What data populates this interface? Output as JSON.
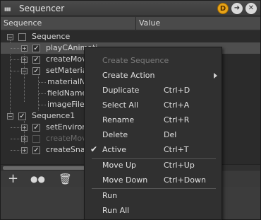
{
  "window": {
    "title": "Sequencer",
    "title_icons": [
      "d-badge-icon",
      "arrow-right-icon",
      "close-icon"
    ],
    "d_badge": "D"
  },
  "columns": {
    "sequence": "Sequence",
    "value": "Value"
  },
  "tree": {
    "rows": [
      {
        "label": "Sequence",
        "checked": false
      },
      {
        "label": "playCAnimati",
        "checked": true
      },
      {
        "label": "createMov",
        "checked": true
      },
      {
        "label": "setMateria",
        "checked": true
      },
      {
        "label": "materialNa"
      },
      {
        "label": "fieldName"
      },
      {
        "label": "imageFiler"
      },
      {
        "label": "Sequence1",
        "checked": true
      },
      {
        "label": "setEnviron",
        "checked": true
      },
      {
        "label": "createMov",
        "checked": false
      },
      {
        "label": "createSnap",
        "checked": true
      }
    ]
  },
  "toolbar": {
    "icons": [
      "add-icon",
      "record-icon",
      "trash-icon"
    ],
    "add_glyph": "+",
    "record_glyph": "●●",
    "trash_glyph": "🗑"
  },
  "context_menu": {
    "items": [
      {
        "label": "Create Sequence",
        "shortcut": "",
        "disabled": true
      },
      {
        "label": "Create Action",
        "shortcut": "",
        "submenu": true
      },
      {
        "label": "Duplicate",
        "shortcut": "Ctrl+D"
      },
      {
        "label": "Select All",
        "shortcut": "Ctrl+A"
      },
      {
        "label": "Rename",
        "shortcut": "Ctrl+R"
      },
      {
        "label": "Delete",
        "shortcut": "Del"
      },
      {
        "label": "Active",
        "shortcut": "Ctrl+T",
        "checked": true
      },
      {
        "label": "Move Up",
        "shortcut": "Ctrl+Up"
      },
      {
        "label": "Move Down",
        "shortcut": "Ctrl+Down"
      },
      {
        "label": "Run",
        "shortcut": ""
      },
      {
        "label": "Run All",
        "shortcut": ""
      }
    ],
    "check_glyph": "✔"
  },
  "colors": {
    "badge": "#e8a317",
    "background": "#2b2b2b",
    "menu_background": "#303030"
  }
}
